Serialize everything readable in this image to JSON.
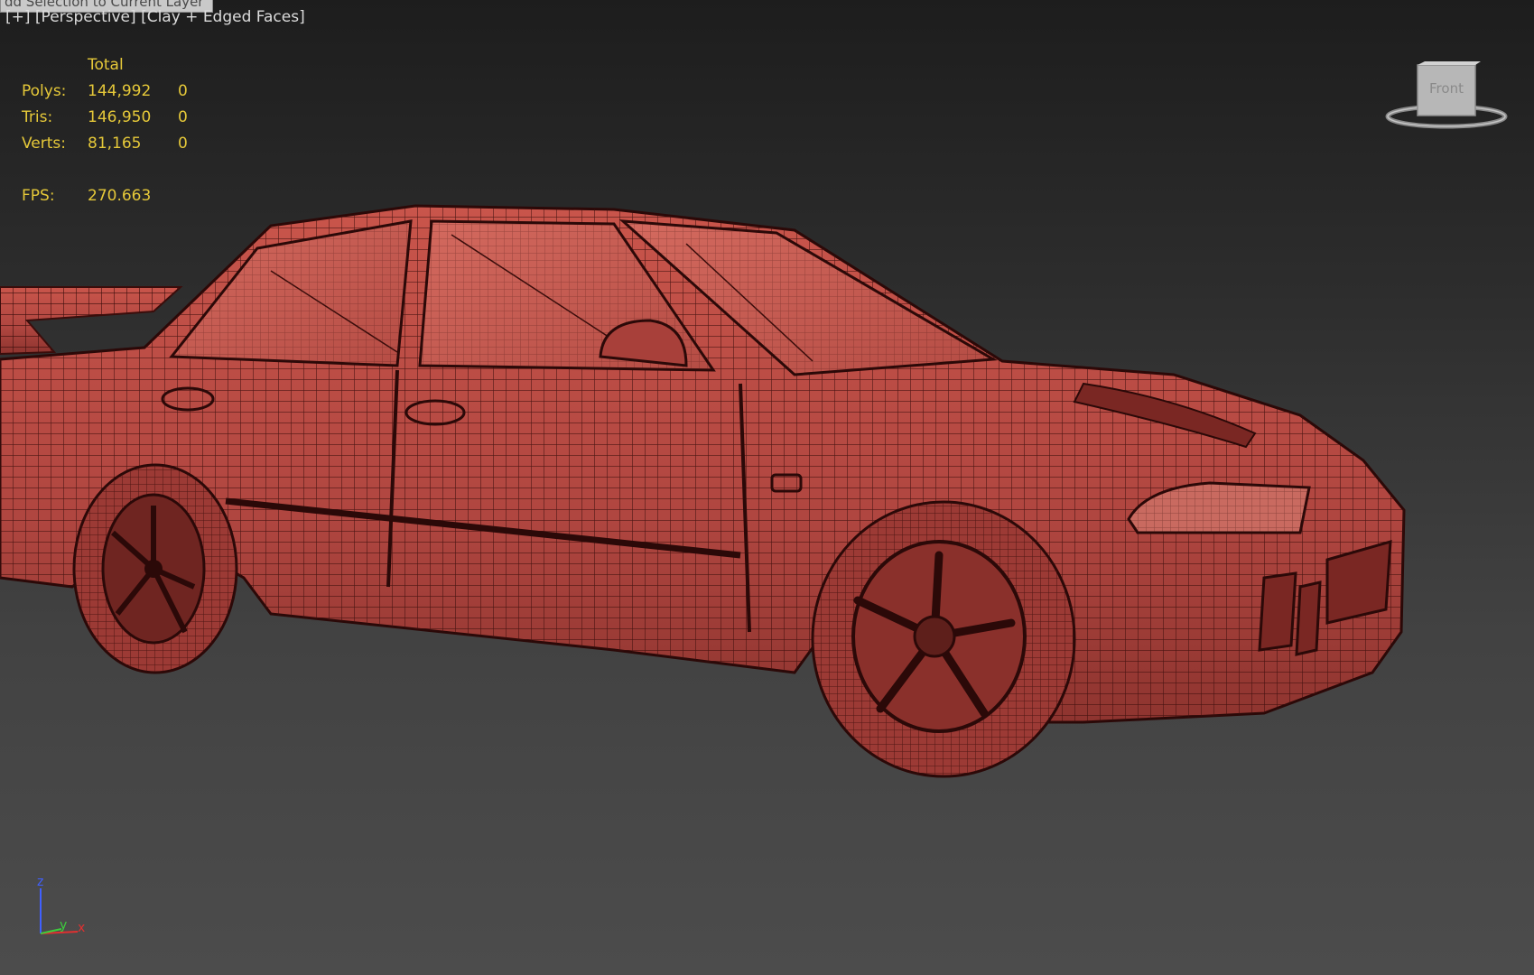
{
  "viewport": {
    "tooltip": "dd Selection to Current Layer",
    "label_plus": "[+]",
    "label_view": "[Perspective]",
    "label_shading": "[Clay + Edged Faces]"
  },
  "stats": {
    "header": "Total",
    "rows": [
      {
        "label": "Polys:",
        "total": "144,992",
        "selected": "0"
      },
      {
        "label": "Tris:",
        "total": "146,950",
        "selected": "0"
      },
      {
        "label": "Verts:",
        "total": "81,165",
        "selected": "0"
      }
    ],
    "fps_label": "FPS:",
    "fps_value": "270.663"
  },
  "viewcube": {
    "face": "Front"
  },
  "triad": {
    "z": "z",
    "y": "y",
    "x": "x"
  },
  "colors": {
    "stats_text": "#e5c839",
    "mesh_fill": "#b4473f",
    "wire": "#3a0d0b",
    "axis_z": "#4060ff",
    "axis_y": "#3ccd3c",
    "axis_x": "#e03030"
  }
}
